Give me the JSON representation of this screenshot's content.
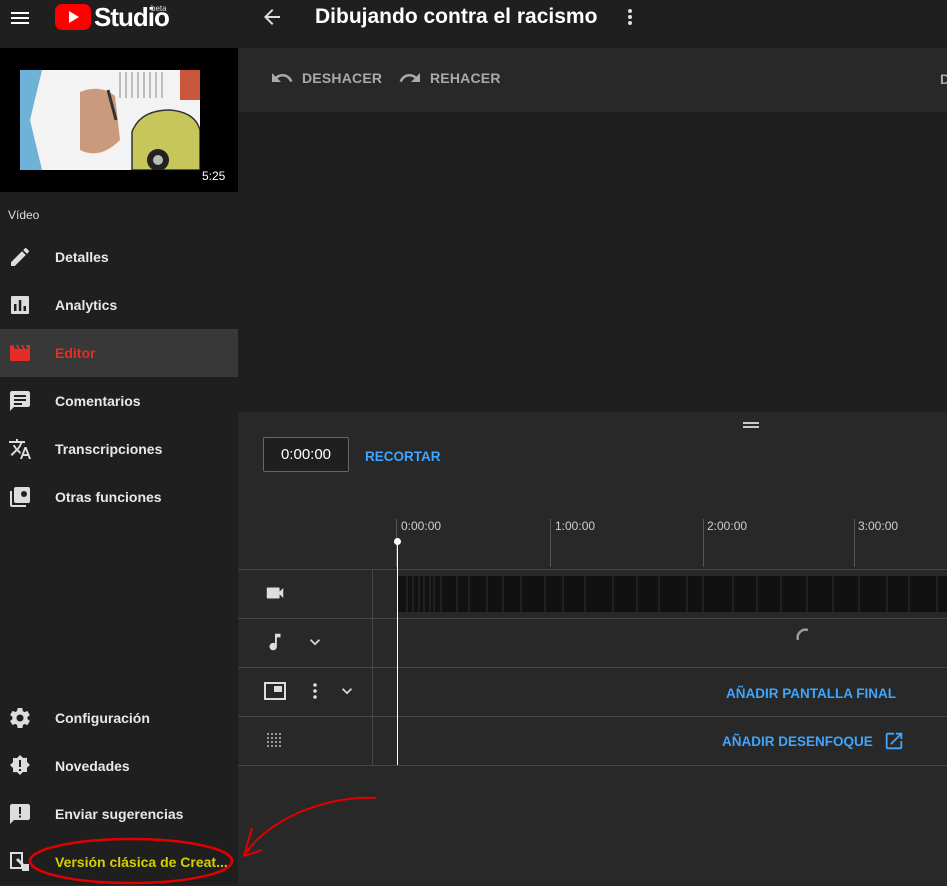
{
  "header": {
    "brand": "Studio",
    "brand_tag": "beta",
    "video_title": "Dibujando contra el racismo"
  },
  "thumbnail": {
    "duration": "5:25"
  },
  "sidebar": {
    "section_label": "Vídeo",
    "items": [
      {
        "label": "Detalles",
        "icon": "pencil-icon"
      },
      {
        "label": "Analytics",
        "icon": "analytics-icon"
      },
      {
        "label": "Editor",
        "icon": "clapperboard-icon",
        "active": true
      },
      {
        "label": "Comentarios",
        "icon": "comment-icon"
      },
      {
        "label": "Transcripciones",
        "icon": "translate-icon"
      },
      {
        "label": "Otras funciones",
        "icon": "other-features-icon"
      }
    ],
    "bottom_items": [
      {
        "label": "Configuración",
        "icon": "gear-icon"
      },
      {
        "label": "Novedades",
        "icon": "news-icon"
      },
      {
        "label": "Enviar sugerencias",
        "icon": "feedback-icon"
      },
      {
        "label": "Versión clásica de Creat...",
        "icon": "classic-icon"
      }
    ]
  },
  "toolbar": {
    "undo_label": "DESHACER",
    "redo_label": "REHACER",
    "clipped_label": "D"
  },
  "timeline": {
    "time_value": "0:00:00",
    "trim_label": "RECORTAR",
    "ticks": [
      "0:00:00",
      "1:00:00",
      "2:00:00",
      "3:00:00"
    ],
    "add_end_screen_label": "AÑADIR PANTALLA FINAL",
    "add_blur_label": "AÑADIR DESENFOQUE"
  },
  "colors": {
    "accent_red": "#e52d27",
    "link_blue": "#3ea6ff",
    "annotation_red": "#e00000",
    "highlight_text": "#d4d000"
  }
}
